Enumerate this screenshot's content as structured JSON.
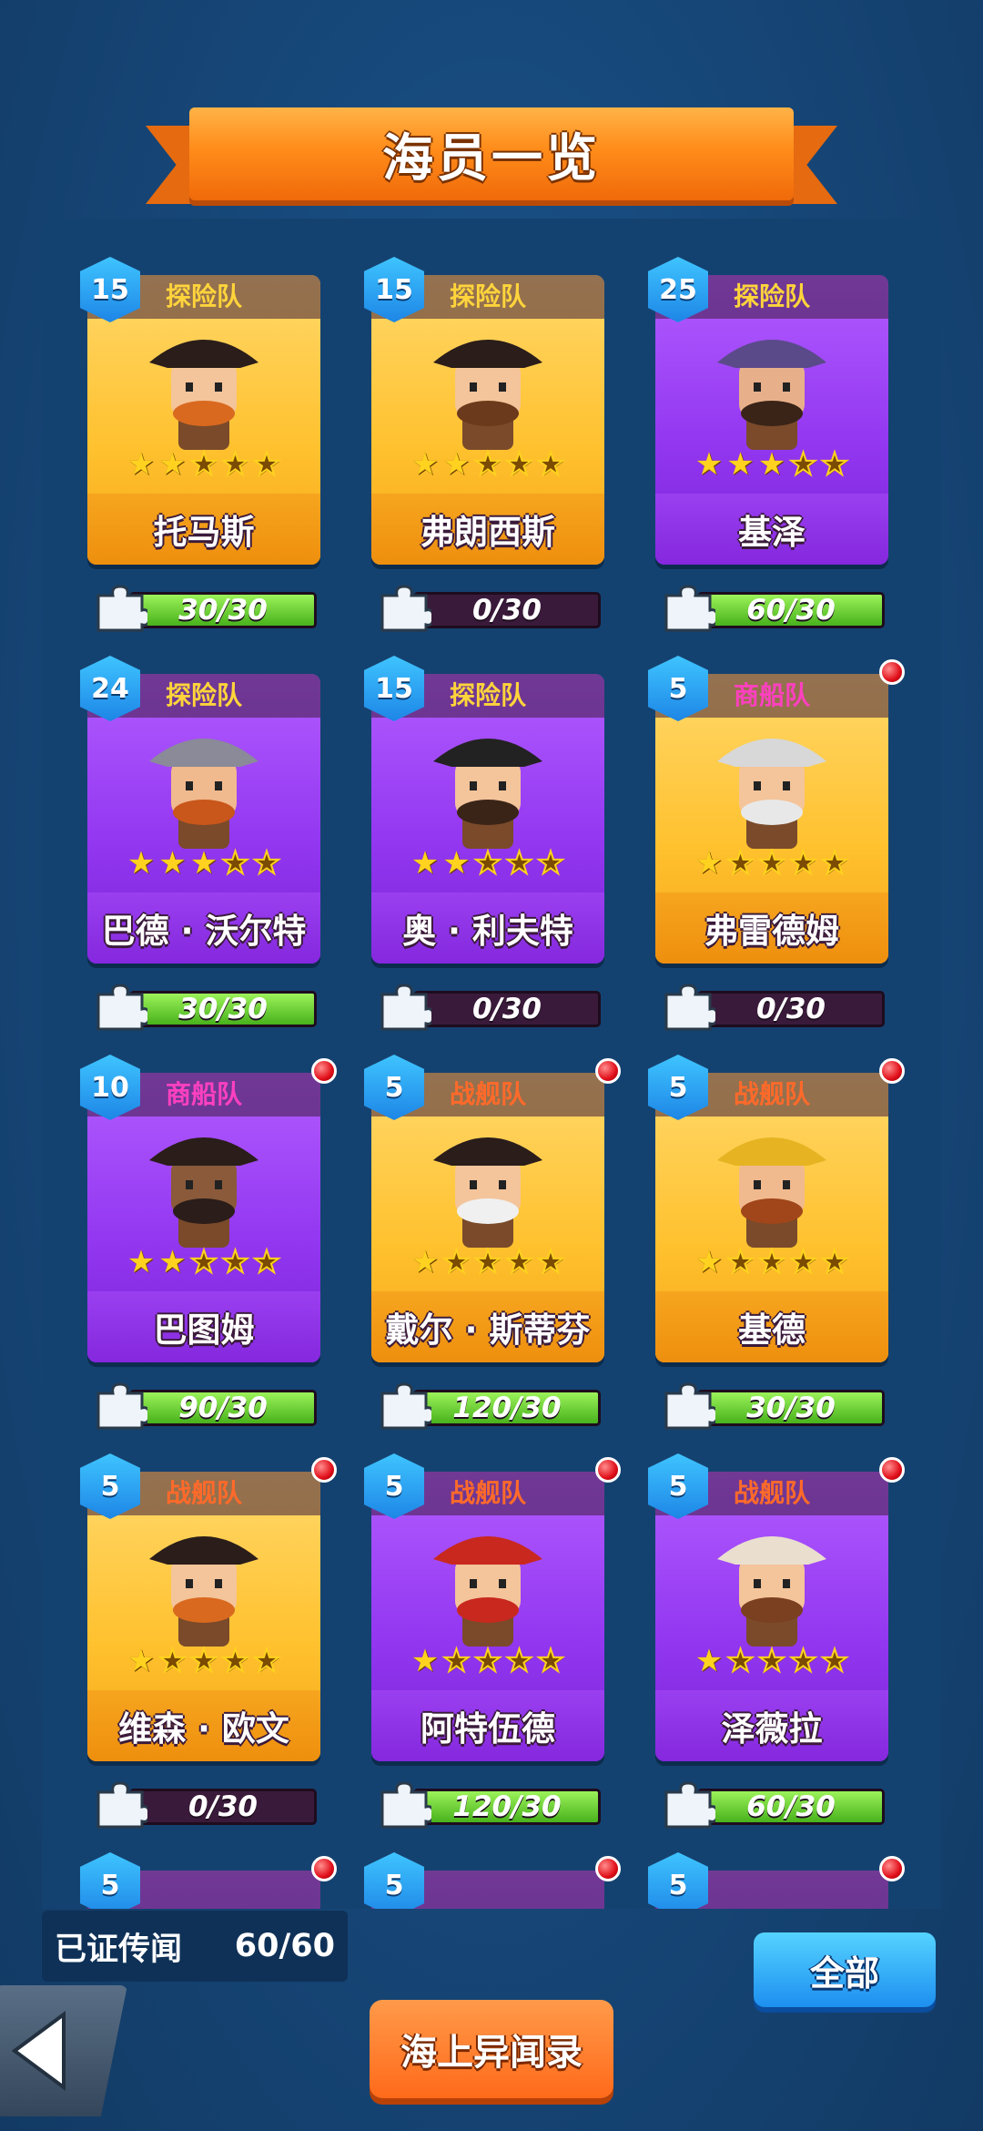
{
  "header": {
    "title": "海员一览"
  },
  "crew": [
    {
      "level": "15",
      "team": "探险队",
      "team_type": "explore",
      "name": "托马斯",
      "stars": 2,
      "progress": "30/30",
      "fill": 1.0,
      "theme": "gold",
      "new": false,
      "portrait": "pirate-captain"
    },
    {
      "level": "15",
      "team": "探险队",
      "team_type": "explore",
      "name": "弗朗西斯",
      "stars": 2,
      "progress": "0/30",
      "fill": 0,
      "theme": "gold",
      "new": false,
      "portrait": "bearded-pirate"
    },
    {
      "level": "25",
      "team": "探险队",
      "team_type": "explore",
      "name": "基泽",
      "stars": 3,
      "progress": "60/30",
      "fill": 1.0,
      "theme": "purple",
      "new": false,
      "portrait": "wizard"
    },
    {
      "level": "24",
      "team": "探险队",
      "team_type": "explore",
      "name": "巴德 · 沃尔特",
      "stars": 3,
      "progress": "30/30",
      "fill": 1.0,
      "theme": "purple",
      "new": false,
      "portrait": "viking"
    },
    {
      "level": "15",
      "team": "探险队",
      "team_type": "explore",
      "name": "奥 · 利夫特",
      "stars": 2,
      "progress": "0/30",
      "fill": 0,
      "theme": "purple",
      "new": false,
      "portrait": "cowboy"
    },
    {
      "level": "5",
      "team": "商船队",
      "team_type": "merchant",
      "name": "弗雷德姆",
      "stars": 1,
      "progress": "0/30",
      "fill": 0,
      "theme": "gold",
      "new": true,
      "portrait": "old-man"
    },
    {
      "level": "10",
      "team": "商船队",
      "team_type": "merchant",
      "name": "巴图姆",
      "stars": 2,
      "progress": "90/30",
      "fill": 1.0,
      "theme": "purple",
      "new": true,
      "portrait": "lady"
    },
    {
      "level": "5",
      "team": "战舰队",
      "team_type": "war",
      "name": "戴尔 · 斯蒂芬",
      "stars": 1,
      "progress": "120/30",
      "fill": 1.0,
      "theme": "gold",
      "new": true,
      "portrait": "admiral"
    },
    {
      "level": "5",
      "team": "战舰队",
      "team_type": "war",
      "name": "基德",
      "stars": 1,
      "progress": "30/30",
      "fill": 1.0,
      "theme": "gold",
      "new": true,
      "portrait": "king"
    },
    {
      "level": "5",
      "team": "战舰队",
      "team_type": "war",
      "name": "维森 · 欧文",
      "stars": 1,
      "progress": "0/30",
      "fill": 0,
      "theme": "gold",
      "new": true,
      "portrait": "pirate-captain"
    },
    {
      "level": "5",
      "team": "战舰队",
      "team_type": "war",
      "name": "阿特伍德",
      "stars": 1,
      "progress": "120/30",
      "fill": 1.0,
      "theme": "purple",
      "new": true,
      "portrait": "red-hair"
    },
    {
      "level": "5",
      "team": "战舰队",
      "team_type": "war",
      "name": "泽薇拉",
      "stars": 1,
      "progress": "60/30",
      "fill": 1.0,
      "theme": "purple",
      "new": true,
      "portrait": "viking-girl"
    },
    {
      "level": "5",
      "team": "",
      "team_type": "",
      "name": "",
      "stars": 0,
      "progress": "",
      "fill": 0,
      "theme": "purple",
      "new": true,
      "portrait": ""
    },
    {
      "level": "5",
      "team": "",
      "team_type": "",
      "name": "",
      "stars": 0,
      "progress": "",
      "fill": 0,
      "theme": "purple",
      "new": true,
      "portrait": ""
    },
    {
      "level": "5",
      "team": "",
      "team_type": "",
      "name": "",
      "stars": 0,
      "progress": "",
      "fill": 0,
      "theme": "purple",
      "new": true,
      "portrait": ""
    }
  ],
  "footer": {
    "summary_label": "已证传闻",
    "summary_value": "60/60",
    "all_button": "全部",
    "sea_button": "海上异闻录"
  },
  "icons": {
    "back": "back-arrow-icon",
    "puzzle": "puzzle-piece-icon",
    "star": "star-icon",
    "notification": "notification-dot-icon"
  },
  "colors": {
    "background": "#17497c",
    "gold_card": "#ffc12e",
    "purple_card": "#9236f0",
    "progress_green": "#48b21c",
    "accent_orange": "#ff6a1a"
  }
}
